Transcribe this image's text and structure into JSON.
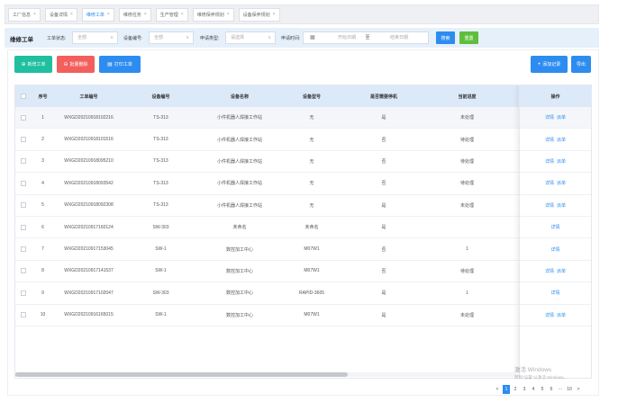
{
  "tabs": [
    {
      "label": "工厂信息"
    },
    {
      "label": "设备详情"
    },
    {
      "label": "维修工单"
    },
    {
      "label": "维修任务"
    },
    {
      "label": "生产管理"
    },
    {
      "label": "维修保养规划"
    },
    {
      "label": "设备保养规划"
    }
  ],
  "filter": {
    "title": "维修工单",
    "status_label": "工单状态:",
    "status_value": "全部",
    "device_label": "设备编号:",
    "device_value": "全部",
    "type_label": "申请类型:",
    "type_placeholder": "请选择",
    "time_label": "申请时间:",
    "start_placeholder": "开始日期",
    "range_sep": "至",
    "end_placeholder": "结束日期",
    "search_label": "搜索",
    "reset_label": "重置"
  },
  "toolbar": {
    "add_label": "新增工单",
    "batch_delete_label": "批量删除",
    "print_label": "打印工单",
    "add_record_label": "添加记录",
    "export_label": "导出"
  },
  "table": {
    "columns": [
      "序号",
      "工单编号",
      "设备编号",
      "设备名称",
      "设备型号",
      "是否需要停机",
      "当前进度",
      "操作"
    ],
    "rows": [
      {
        "index": "1",
        "order_no": "WXGD20210918102216",
        "device_no": "TS-313",
        "device_name": "小件机器人焊接工作站",
        "device_model": "无",
        "need_stop": "是",
        "progress": "未处理",
        "ops": [
          "详情",
          "派单"
        ]
      },
      {
        "index": "2",
        "order_no": "WXGD20210918101516",
        "device_no": "TS-313",
        "device_name": "小件机器人焊接工作站",
        "device_model": "无",
        "need_stop": "否",
        "progress": "待处理",
        "ops": [
          "详情",
          "派单"
        ]
      },
      {
        "index": "3",
        "order_no": "WXGD20210918095210",
        "device_no": "TS-313",
        "device_name": "小件机器人焊接工作站",
        "device_model": "无",
        "need_stop": "否",
        "progress": "待处理",
        "ops": [
          "详情",
          "派单"
        ]
      },
      {
        "index": "4",
        "order_no": "WXGD20210918093542",
        "device_no": "TS-313",
        "device_name": "小件机器人焊接工作站",
        "device_model": "无",
        "need_stop": "否",
        "progress": "待处理",
        "ops": [
          "详情",
          "派单"
        ]
      },
      {
        "index": "5",
        "order_no": "WXGD20210918092308",
        "device_no": "TS-313",
        "device_name": "小件机器人焊接工作站",
        "device_model": "无",
        "need_stop": "是",
        "progress": "未处理",
        "ops": [
          "详情",
          "派单"
        ]
      },
      {
        "index": "6",
        "order_no": "WXGD20210917160124",
        "device_no": "SW-303",
        "device_name": "未命名",
        "device_model": "未命名",
        "need_stop": "是",
        "progress": "",
        "ops": [
          "详情"
        ]
      },
      {
        "index": "7",
        "order_no": "WXGD20210917153045",
        "device_no": "SW-1",
        "device_name": "数控加工中心",
        "device_model": "M07W1",
        "need_stop": "否",
        "progress": "1",
        "ops": [
          "详情"
        ]
      },
      {
        "index": "8",
        "order_no": "WXGD20210917141537",
        "device_no": "SW-1",
        "device_name": "数控加工中心",
        "device_model": "M07W1",
        "need_stop": "否",
        "progress": "待处理",
        "ops": [
          "详情",
          "派单"
        ]
      },
      {
        "index": "9",
        "order_no": "WXGD20210917102047",
        "device_no": "SW-303",
        "device_name": "数控加工中心",
        "device_model": "RAPID-3605",
        "need_stop": "是",
        "progress": "1",
        "ops": [
          "详情"
        ]
      },
      {
        "index": "10",
        "order_no": "WXGD20210916165015",
        "device_no": "SW-1",
        "device_name": "数控加工中心",
        "device_model": "M07W1",
        "need_stop": "是",
        "progress": "未处理",
        "ops": [
          "详情",
          "派单"
        ]
      }
    ]
  },
  "pagination": {
    "pages": [
      "1",
      "2",
      "3",
      "4",
      "5",
      "6",
      "···",
      "10"
    ],
    "current": "1"
  },
  "watermark": {
    "line1": "激活 Windows",
    "line2": "转到\"设置\"以激活 Windows。"
  },
  "icons": {
    "tab_close": "close-icon",
    "select": "chevron-down-icon",
    "date": "calendar-icon",
    "add": "plus-circle-icon",
    "delete": "minus-circle-icon",
    "print": "list-icon",
    "add_record": "plus-icon",
    "prev": "chevron-left-icon",
    "next": "chevron-right-icon"
  },
  "colors": {
    "primary": "#2d8cf0",
    "add_button": "#1fbf9f",
    "delete_button": "#f25f5c",
    "reset_button": "#5fbf3c",
    "table_header": "#dce9f8",
    "filter_bar": "#e6f0fb"
  }
}
